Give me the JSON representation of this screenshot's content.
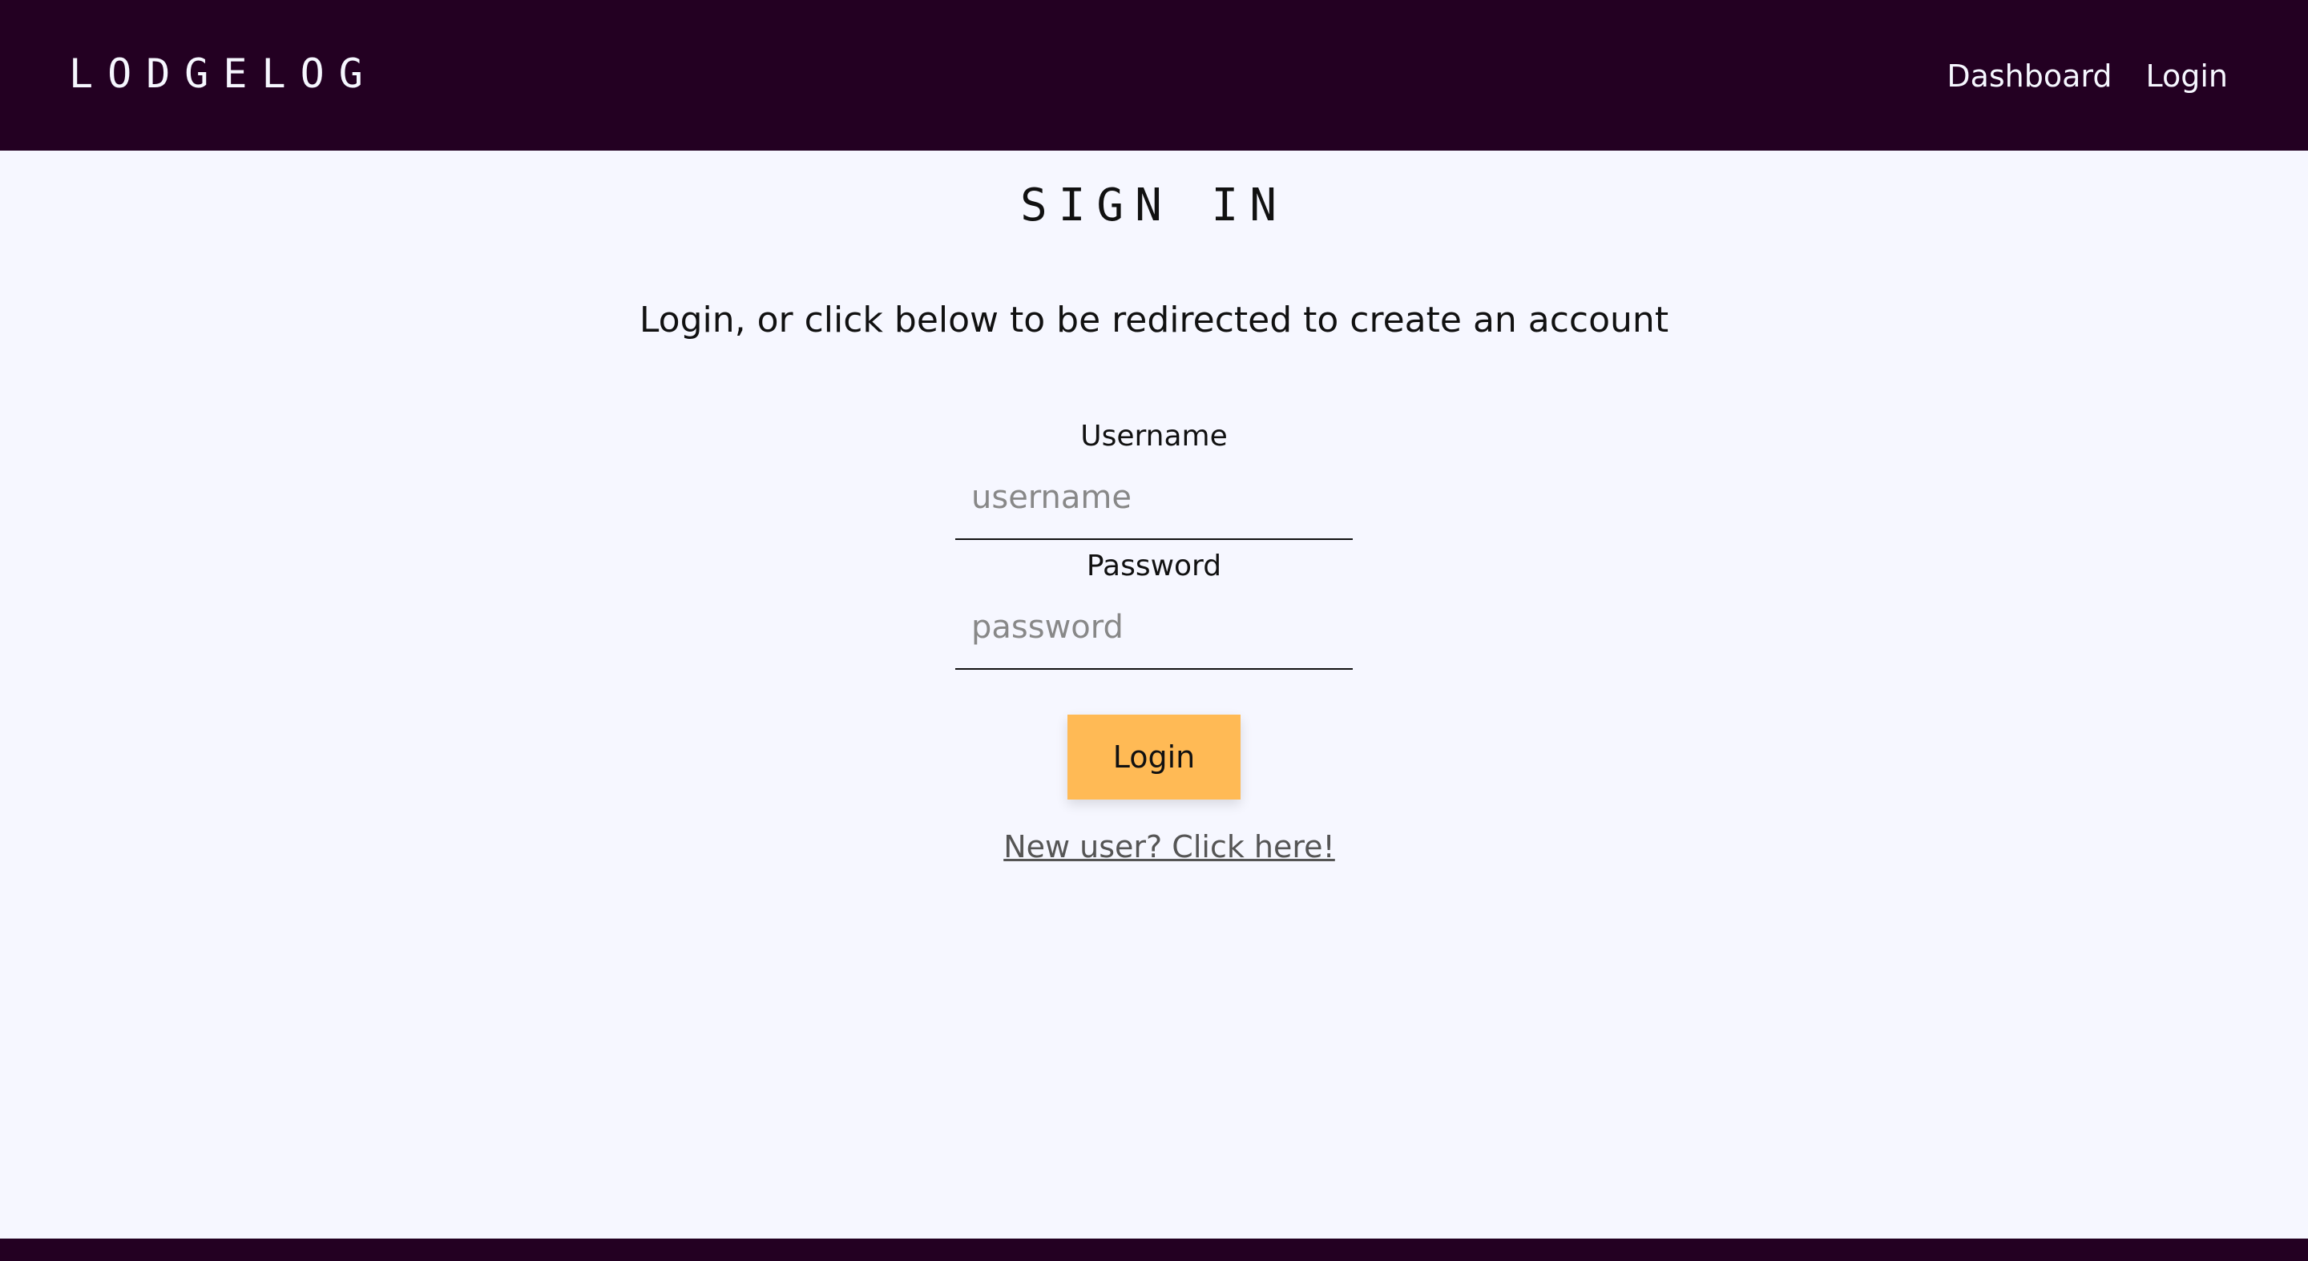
{
  "nav": {
    "brand": "LODGELOG",
    "links": [
      "Dashboard",
      "Login"
    ]
  },
  "page": {
    "title": "SIGN IN",
    "subtitle": "Login, or click below to be redirected to create an account"
  },
  "form": {
    "username_label": "Username",
    "username_placeholder": "username",
    "username_value": "",
    "password_label": "Password",
    "password_placeholder": "password",
    "password_value": "",
    "submit_label": "Login"
  },
  "signup": {
    "link_text": "New user? Click here!"
  },
  "colors": {
    "navbar_bg": "#230022",
    "page_bg": "#f6f7ff",
    "accent_button": "#ffba55",
    "link_color": "#555555"
  }
}
